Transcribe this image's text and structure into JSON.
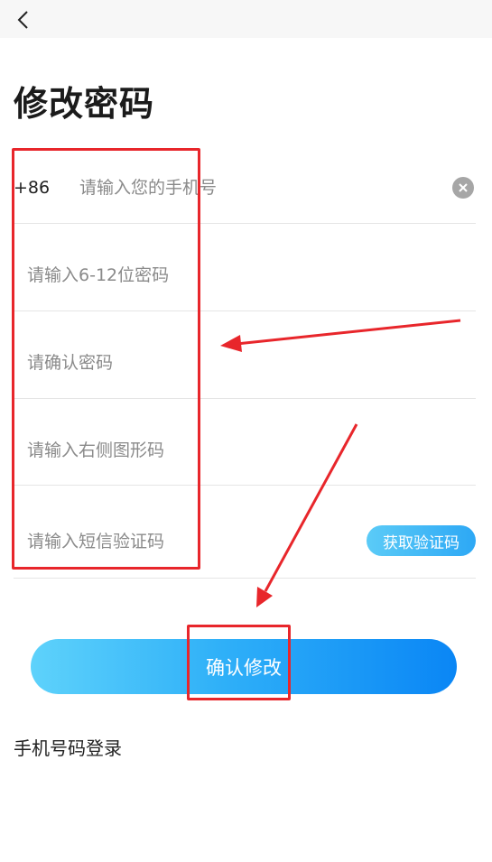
{
  "header": {
    "back_icon": "chevron-left-icon"
  },
  "page_title": "修改密码",
  "form": {
    "phone": {
      "country_code": "+86",
      "placeholder": "请输入您的手机号",
      "value": "",
      "clear_icon": "clear-circle-icon"
    },
    "password": {
      "placeholder": "请输入6-12位密码",
      "value": ""
    },
    "confirm_password": {
      "placeholder": "请确认密码",
      "value": ""
    },
    "captcha": {
      "placeholder": "请输入右侧图形码",
      "value": ""
    },
    "sms_code": {
      "placeholder": "请输入短信验证码",
      "value": "",
      "button_label": "获取验证码"
    }
  },
  "submit": {
    "label": "确认修改"
  },
  "links": {
    "phone_login": "手机号码登录"
  },
  "colors": {
    "accent_start": "#5ed2fb",
    "accent_end": "#0a86f5",
    "annotation": "#e8262b"
  }
}
